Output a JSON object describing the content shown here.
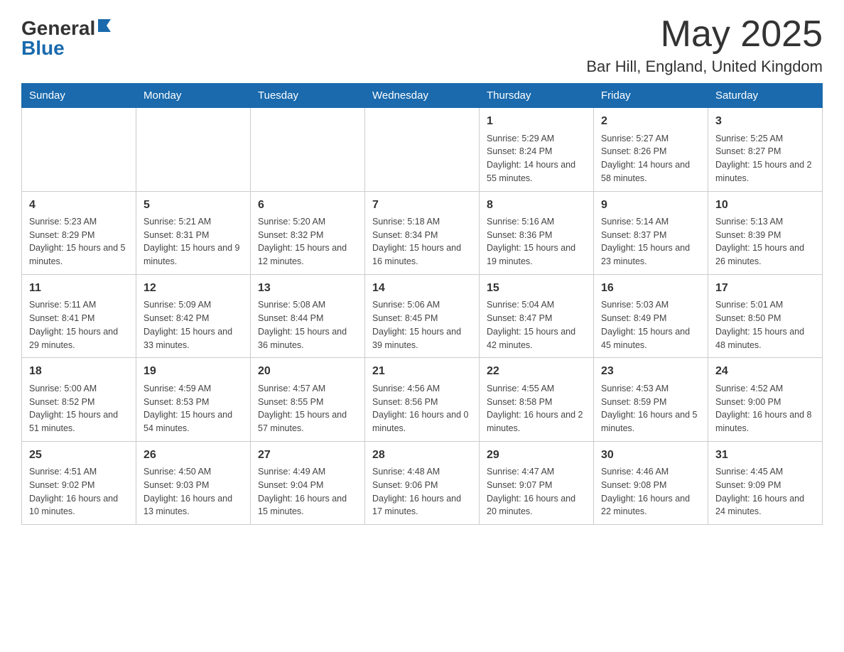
{
  "logo": {
    "general": "General",
    "blue": "Blue"
  },
  "header": {
    "month_year": "May 2025",
    "location": "Bar Hill, England, United Kingdom"
  },
  "weekdays": [
    "Sunday",
    "Monday",
    "Tuesday",
    "Wednesday",
    "Thursday",
    "Friday",
    "Saturday"
  ],
  "weeks": [
    [
      {
        "day": "",
        "info": ""
      },
      {
        "day": "",
        "info": ""
      },
      {
        "day": "",
        "info": ""
      },
      {
        "day": "",
        "info": ""
      },
      {
        "day": "1",
        "info": "Sunrise: 5:29 AM\nSunset: 8:24 PM\nDaylight: 14 hours and 55 minutes."
      },
      {
        "day": "2",
        "info": "Sunrise: 5:27 AM\nSunset: 8:26 PM\nDaylight: 14 hours and 58 minutes."
      },
      {
        "day": "3",
        "info": "Sunrise: 5:25 AM\nSunset: 8:27 PM\nDaylight: 15 hours and 2 minutes."
      }
    ],
    [
      {
        "day": "4",
        "info": "Sunrise: 5:23 AM\nSunset: 8:29 PM\nDaylight: 15 hours and 5 minutes."
      },
      {
        "day": "5",
        "info": "Sunrise: 5:21 AM\nSunset: 8:31 PM\nDaylight: 15 hours and 9 minutes."
      },
      {
        "day": "6",
        "info": "Sunrise: 5:20 AM\nSunset: 8:32 PM\nDaylight: 15 hours and 12 minutes."
      },
      {
        "day": "7",
        "info": "Sunrise: 5:18 AM\nSunset: 8:34 PM\nDaylight: 15 hours and 16 minutes."
      },
      {
        "day": "8",
        "info": "Sunrise: 5:16 AM\nSunset: 8:36 PM\nDaylight: 15 hours and 19 minutes."
      },
      {
        "day": "9",
        "info": "Sunrise: 5:14 AM\nSunset: 8:37 PM\nDaylight: 15 hours and 23 minutes."
      },
      {
        "day": "10",
        "info": "Sunrise: 5:13 AM\nSunset: 8:39 PM\nDaylight: 15 hours and 26 minutes."
      }
    ],
    [
      {
        "day": "11",
        "info": "Sunrise: 5:11 AM\nSunset: 8:41 PM\nDaylight: 15 hours and 29 minutes."
      },
      {
        "day": "12",
        "info": "Sunrise: 5:09 AM\nSunset: 8:42 PM\nDaylight: 15 hours and 33 minutes."
      },
      {
        "day": "13",
        "info": "Sunrise: 5:08 AM\nSunset: 8:44 PM\nDaylight: 15 hours and 36 minutes."
      },
      {
        "day": "14",
        "info": "Sunrise: 5:06 AM\nSunset: 8:45 PM\nDaylight: 15 hours and 39 minutes."
      },
      {
        "day": "15",
        "info": "Sunrise: 5:04 AM\nSunset: 8:47 PM\nDaylight: 15 hours and 42 minutes."
      },
      {
        "day": "16",
        "info": "Sunrise: 5:03 AM\nSunset: 8:49 PM\nDaylight: 15 hours and 45 minutes."
      },
      {
        "day": "17",
        "info": "Sunrise: 5:01 AM\nSunset: 8:50 PM\nDaylight: 15 hours and 48 minutes."
      }
    ],
    [
      {
        "day": "18",
        "info": "Sunrise: 5:00 AM\nSunset: 8:52 PM\nDaylight: 15 hours and 51 minutes."
      },
      {
        "day": "19",
        "info": "Sunrise: 4:59 AM\nSunset: 8:53 PM\nDaylight: 15 hours and 54 minutes."
      },
      {
        "day": "20",
        "info": "Sunrise: 4:57 AM\nSunset: 8:55 PM\nDaylight: 15 hours and 57 minutes."
      },
      {
        "day": "21",
        "info": "Sunrise: 4:56 AM\nSunset: 8:56 PM\nDaylight: 16 hours and 0 minutes."
      },
      {
        "day": "22",
        "info": "Sunrise: 4:55 AM\nSunset: 8:58 PM\nDaylight: 16 hours and 2 minutes."
      },
      {
        "day": "23",
        "info": "Sunrise: 4:53 AM\nSunset: 8:59 PM\nDaylight: 16 hours and 5 minutes."
      },
      {
        "day": "24",
        "info": "Sunrise: 4:52 AM\nSunset: 9:00 PM\nDaylight: 16 hours and 8 minutes."
      }
    ],
    [
      {
        "day": "25",
        "info": "Sunrise: 4:51 AM\nSunset: 9:02 PM\nDaylight: 16 hours and 10 minutes."
      },
      {
        "day": "26",
        "info": "Sunrise: 4:50 AM\nSunset: 9:03 PM\nDaylight: 16 hours and 13 minutes."
      },
      {
        "day": "27",
        "info": "Sunrise: 4:49 AM\nSunset: 9:04 PM\nDaylight: 16 hours and 15 minutes."
      },
      {
        "day": "28",
        "info": "Sunrise: 4:48 AM\nSunset: 9:06 PM\nDaylight: 16 hours and 17 minutes."
      },
      {
        "day": "29",
        "info": "Sunrise: 4:47 AM\nSunset: 9:07 PM\nDaylight: 16 hours and 20 minutes."
      },
      {
        "day": "30",
        "info": "Sunrise: 4:46 AM\nSunset: 9:08 PM\nDaylight: 16 hours and 22 minutes."
      },
      {
        "day": "31",
        "info": "Sunrise: 4:45 AM\nSunset: 9:09 PM\nDaylight: 16 hours and 24 minutes."
      }
    ]
  ]
}
